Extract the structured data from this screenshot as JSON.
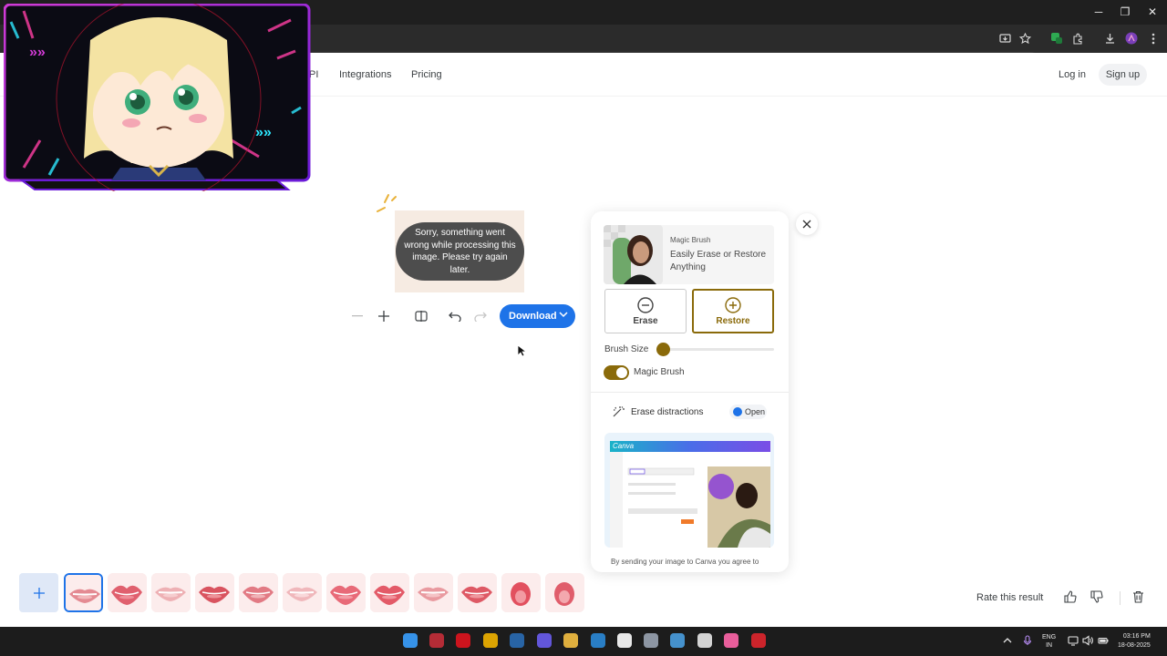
{
  "browser": {
    "window_controls": {
      "minimize": "─",
      "restore": "❐",
      "close": "✕"
    }
  },
  "nav": {
    "links": [
      "PI",
      "Integrations",
      "Pricing"
    ],
    "login": "Log in",
    "signup": "Sign up"
  },
  "preview": {
    "error_message": "Sorry, something went wrong while processing this image. Please try again later."
  },
  "toolbar": {
    "download_label": "Download"
  },
  "panel": {
    "magic_brush_title": "Magic Brush",
    "magic_brush_desc": "Easily Erase or Restore Anything",
    "erase_label": "Erase",
    "restore_label": "Restore",
    "brush_size_label": "Brush Size",
    "brush_size_value": 0.0,
    "magic_brush_toggle_label": "Magic Brush",
    "magic_brush_toggle_on": true,
    "erase_distractions_label": "Erase distractions",
    "open_label": "Open",
    "preview_logo": "Canva",
    "consent_text": "By sending your image to Canva you agree to"
  },
  "bottom": {
    "rate_label": "Rate this result",
    "thumbnail_count": 12
  },
  "taskbar": {
    "lang_top": "ENG",
    "lang_bottom": "IN",
    "time": "03:16 PM",
    "date": "18-08-2025"
  },
  "colors": {
    "accent_blue": "#1e73e8",
    "gold": "#8a6a0a",
    "overlay_border": "#8a2be2"
  }
}
